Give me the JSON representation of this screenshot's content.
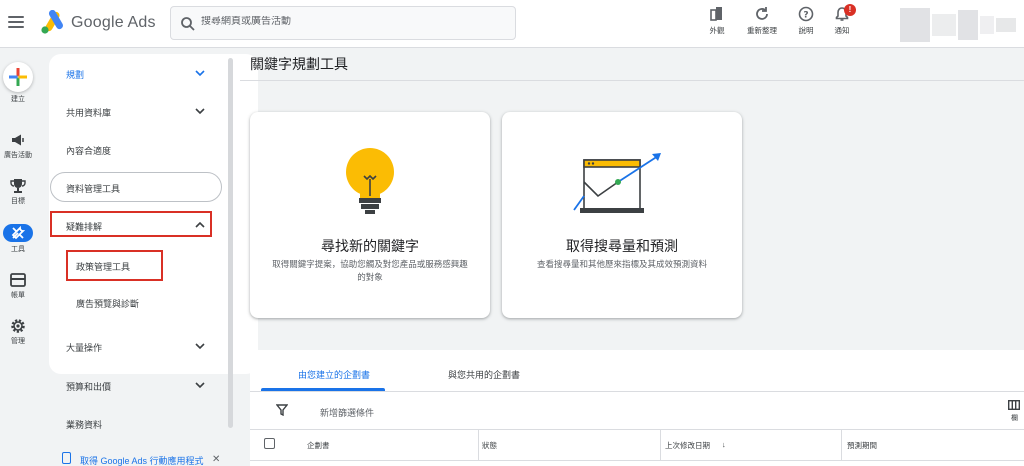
{
  "header": {
    "logo_text": "Google Ads",
    "search_placeholder": "搜尋網頁或廣告活動",
    "actions": [
      {
        "icon": "appearance-icon",
        "label": "外觀"
      },
      {
        "icon": "refresh-icon",
        "label": "重新整理"
      },
      {
        "icon": "help-icon",
        "label": "說明"
      },
      {
        "icon": "bell-icon",
        "label": "通知",
        "badge": "!"
      }
    ]
  },
  "rail": [
    {
      "icon": "plus-icon",
      "label": "建立"
    },
    {
      "icon": "megaphone-icon",
      "label": "廣告活動"
    },
    {
      "icon": "trophy-icon",
      "label": "目標"
    },
    {
      "icon": "tools-icon",
      "label": "工具",
      "active": true
    },
    {
      "icon": "billing-icon",
      "label": "帳單"
    },
    {
      "icon": "gear-icon",
      "label": "管理"
    }
  ],
  "nav": {
    "items": [
      {
        "label": "規劃",
        "chevron": "down",
        "color": "#1a73e8"
      },
      {
        "label": "共用資料庫",
        "chevron": "down"
      },
      {
        "label": "內容合適度"
      },
      {
        "label": "資料管理工具"
      },
      {
        "label": "疑難排解",
        "chevron": "up"
      },
      {
        "label": "政策管理工具"
      },
      {
        "label": "廣告預覽與診斷"
      },
      {
        "label": "大量操作",
        "chevron": "down"
      },
      {
        "label": "預算和出價",
        "chevron": "down"
      },
      {
        "label": "業務資料"
      }
    ],
    "promo": "取得 Google Ads 行動應用程式",
    "promo_close": "✕"
  },
  "main": {
    "title": "關鍵字規劃工具",
    "cards": [
      {
        "title": "尋找新的關鍵字",
        "description": "取得關鍵字提案，協助您觸及對您產品或服務感興趣的對象"
      },
      {
        "title": "取得搜尋量和預測",
        "description": "查看搜尋量和其他歷來指標及其成效預測資料"
      }
    ],
    "tabs": [
      "由您建立的企劃書",
      "與您共用的企劃書"
    ],
    "filter_label": "新增篩選條件",
    "columns_label": "欄",
    "table_headers": [
      "企劃書",
      "狀態",
      "上次修改日期",
      "預測期間"
    ],
    "sort_indicator": "↓"
  },
  "colors": {
    "accent": "#1a73e8",
    "highlight_border": "#d93025",
    "bulb": "#fbbc04"
  }
}
